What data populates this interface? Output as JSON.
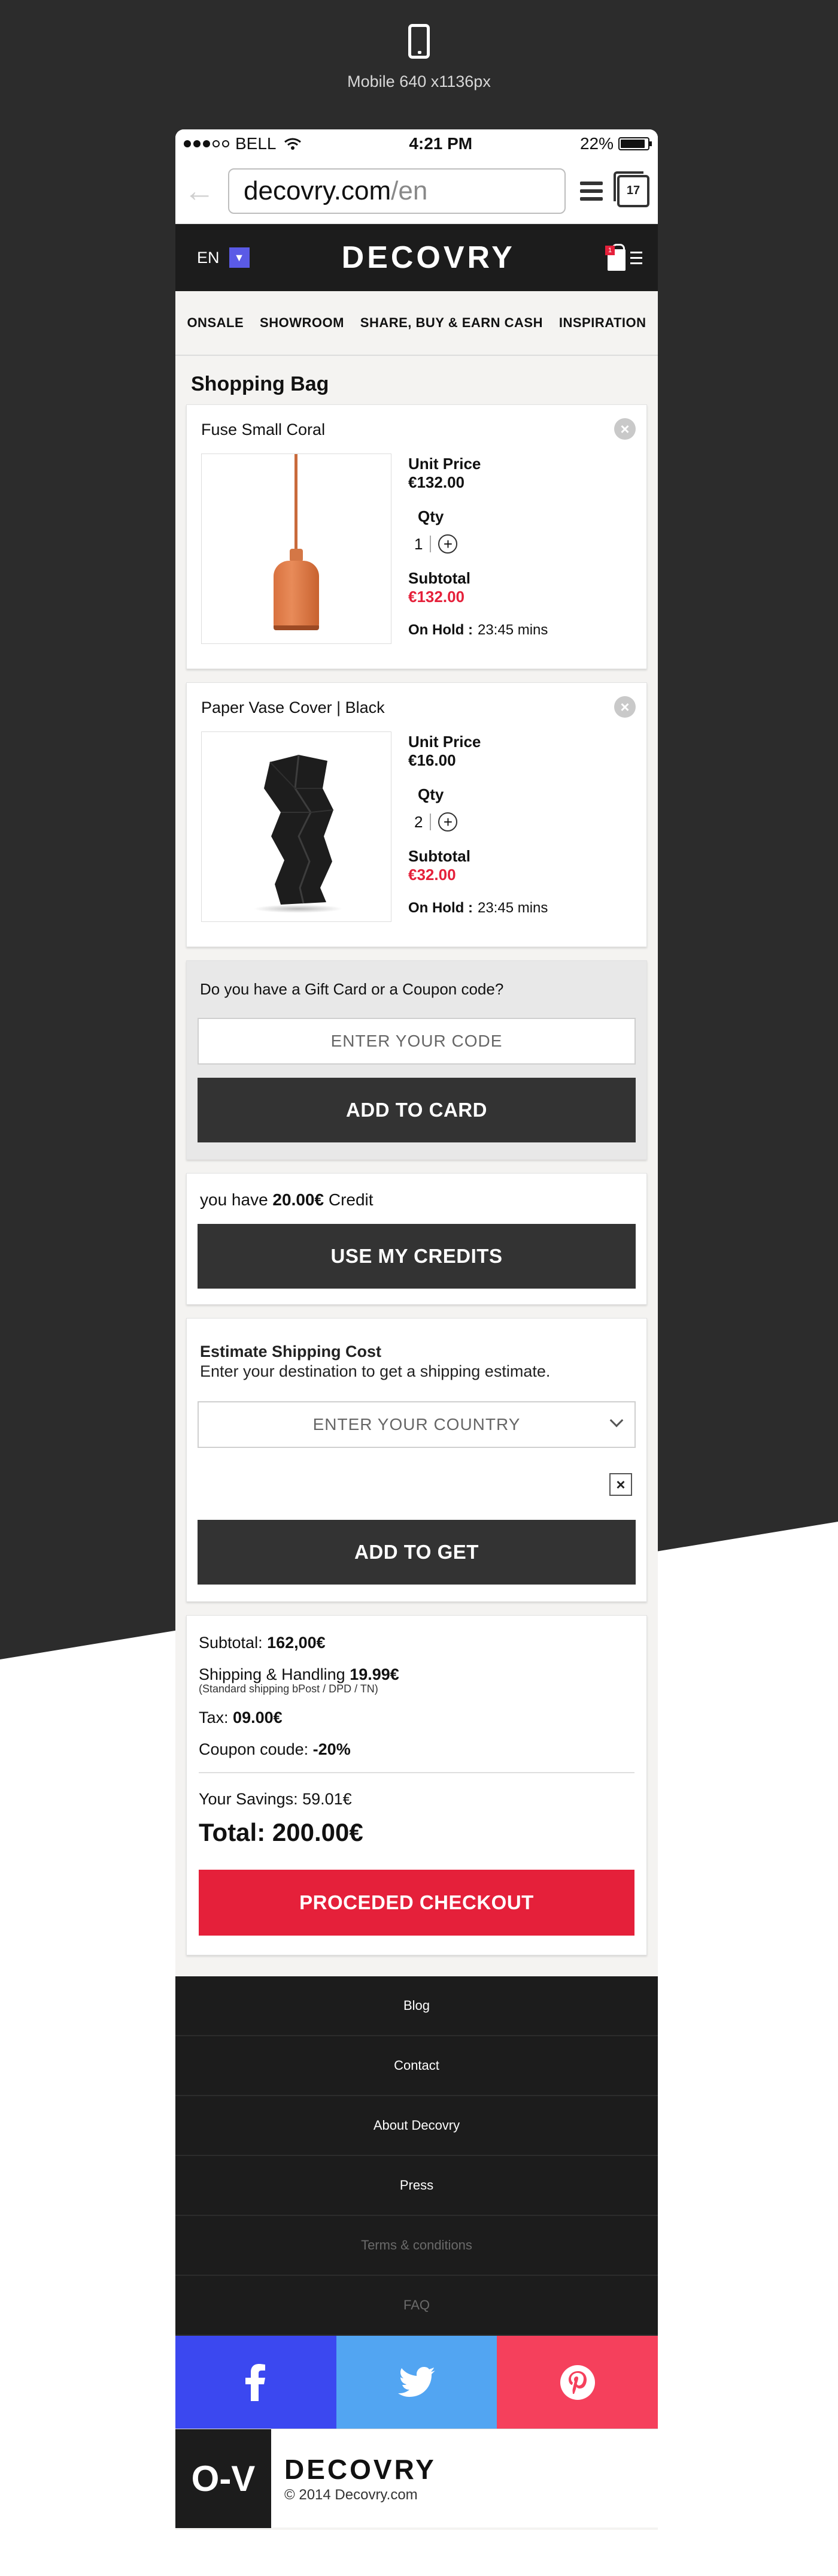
{
  "device": {
    "label": "Mobile 640 x1136px"
  },
  "status_bar": {
    "carrier": "BELL",
    "time": "4:21 PM",
    "battery": "22%"
  },
  "browser": {
    "url_host": "decovry.com",
    "url_path": "/en",
    "tab_count": "17"
  },
  "header": {
    "language": "EN",
    "logo": "DECOVRY",
    "bag_count": "1"
  },
  "nav": [
    "ONSALE",
    "SHOWROOM",
    "SHARE, BUY & EARN CASH",
    "INSPIRATION"
  ],
  "page_title": "Shopping Bag",
  "labels": {
    "unit_price": "Unit Price",
    "qty": "Qty",
    "subtotal": "Subtotal",
    "on_hold": "On Hold :"
  },
  "items": [
    {
      "name": "Fuse Small Coral",
      "unit_price": "€132.00",
      "qty": "1",
      "subtotal": "€132.00",
      "hold_time": "23:45 mins"
    },
    {
      "name": "Paper Vase Cover | Black",
      "unit_price": "€16.00",
      "qty": "2",
      "subtotal": "€32.00",
      "hold_time": "23:45 mins"
    }
  ],
  "coupon": {
    "question": "Do you have a Gift Card or a Coupon code?",
    "placeholder": "ENTER YOUR CODE",
    "button": "ADD TO CARD"
  },
  "credits": {
    "prefix": "you have ",
    "amount": "20.00€",
    "suffix": " Credit",
    "button": "USE MY CREDITS"
  },
  "shipping": {
    "title": "Estimate Shipping Cost",
    "description": "Enter your destination to get a shipping estimate.",
    "placeholder": "ENTER YOUR COUNTRY",
    "button": "ADD TO GET"
  },
  "summary": {
    "subtotal_label": "Subtotal:",
    "subtotal_value": "162,00€",
    "shipping_label": "Shipping & Handling",
    "shipping_value": "19.99€",
    "shipping_note": "(Standard shipping bPost / DPD / TN)",
    "tax_label": "Tax:",
    "tax_value": "09.00€",
    "coupon_label": "Coupon coude:",
    "coupon_value": "-20%",
    "savings": "Your Savings: 59.01€",
    "total": "Total: 200.00€",
    "checkout": "PROCEDED CHECKOUT"
  },
  "footer": {
    "links": [
      "Blog",
      "Contact",
      "About Decovry",
      "Press",
      "Terms & conditions",
      "FAQ"
    ],
    "brand_mark": "O-V",
    "brand_name": "DECOVRY",
    "copyright": "© 2014 Decovry.com"
  },
  "colors": {
    "accent_red": "#e5203a",
    "dark": "#1c1c1c",
    "button": "#333333",
    "facebook": "#3b48f0",
    "twitter": "#52a5f2",
    "pinterest": "#f5405c"
  }
}
